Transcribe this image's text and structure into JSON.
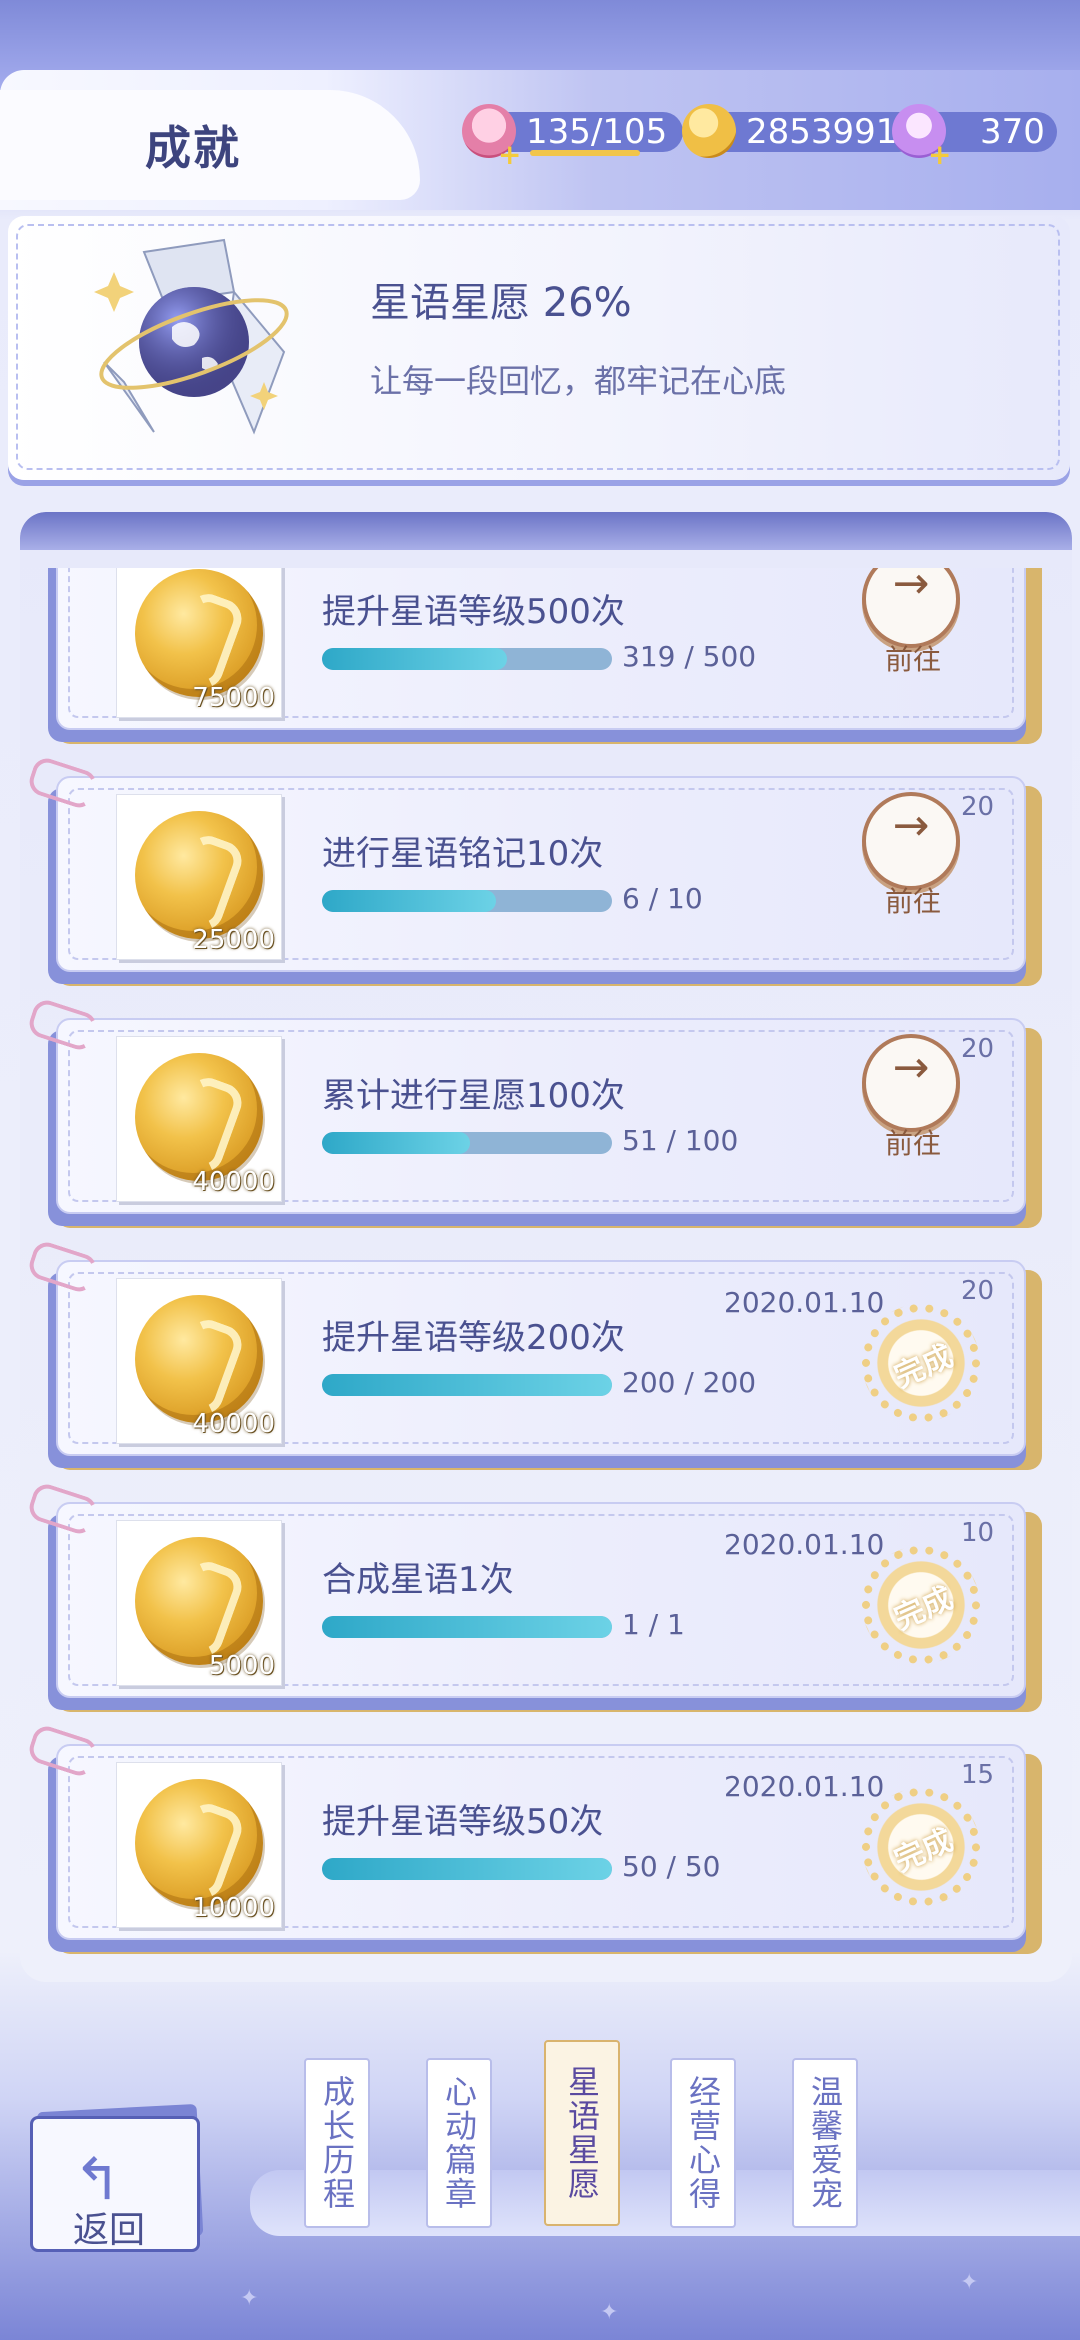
{
  "header": {
    "title": "成就",
    "resources": [
      {
        "icon": "cupcake-icon",
        "value": "135/105"
      },
      {
        "icon": "gold-coin-icon",
        "value": "2853991"
      },
      {
        "icon": "crystal-swan-icon",
        "value": "370"
      }
    ]
  },
  "hero": {
    "title": "星语星愿 26%",
    "subtitle": "让每一段回忆，都牢记在心底"
  },
  "achievements": [
    {
      "title": "提升星语等级500次",
      "reward": "75000",
      "current": 319,
      "total": 500,
      "progress_text": "319 / 500",
      "points": "",
      "date": "",
      "status": "go",
      "action_label": "前往"
    },
    {
      "title": "进行星语铭记10次",
      "reward": "25000",
      "current": 6,
      "total": 10,
      "progress_text": "6 / 10",
      "points": "20",
      "date": "",
      "status": "go",
      "action_label": "前往"
    },
    {
      "title": "累计进行星愿100次",
      "reward": "40000",
      "current": 51,
      "total": 100,
      "progress_text": "51 / 100",
      "points": "20",
      "date": "",
      "status": "go",
      "action_label": "前往"
    },
    {
      "title": "提升星语等级200次",
      "reward": "40000",
      "current": 200,
      "total": 200,
      "progress_text": "200 / 200",
      "points": "20",
      "date": "2020.01.10",
      "status": "done",
      "action_label": "完成"
    },
    {
      "title": "合成星语1次",
      "reward": "5000",
      "current": 1,
      "total": 1,
      "progress_text": "1 / 1",
      "points": "10",
      "date": "2020.01.10",
      "status": "done",
      "action_label": "完成"
    },
    {
      "title": "提升星语等级50次",
      "reward": "10000",
      "current": 50,
      "total": 50,
      "progress_text": "50 / 50",
      "points": "15",
      "date": "2020.01.10",
      "status": "done",
      "action_label": "完成"
    }
  ],
  "nav": {
    "back_label": "返回",
    "tabs": [
      {
        "label": "成长历程",
        "active": false
      },
      {
        "label": "心动篇章",
        "active": false
      },
      {
        "label": "星语星愿",
        "active": true
      },
      {
        "label": "经营心得",
        "active": false
      },
      {
        "label": "温馨爱宠",
        "active": false
      }
    ]
  },
  "colors": {
    "accent": "#6e79d2",
    "progress": "#2ea8c8",
    "go": "#8a5a3e",
    "stamp": "#efcf85"
  }
}
